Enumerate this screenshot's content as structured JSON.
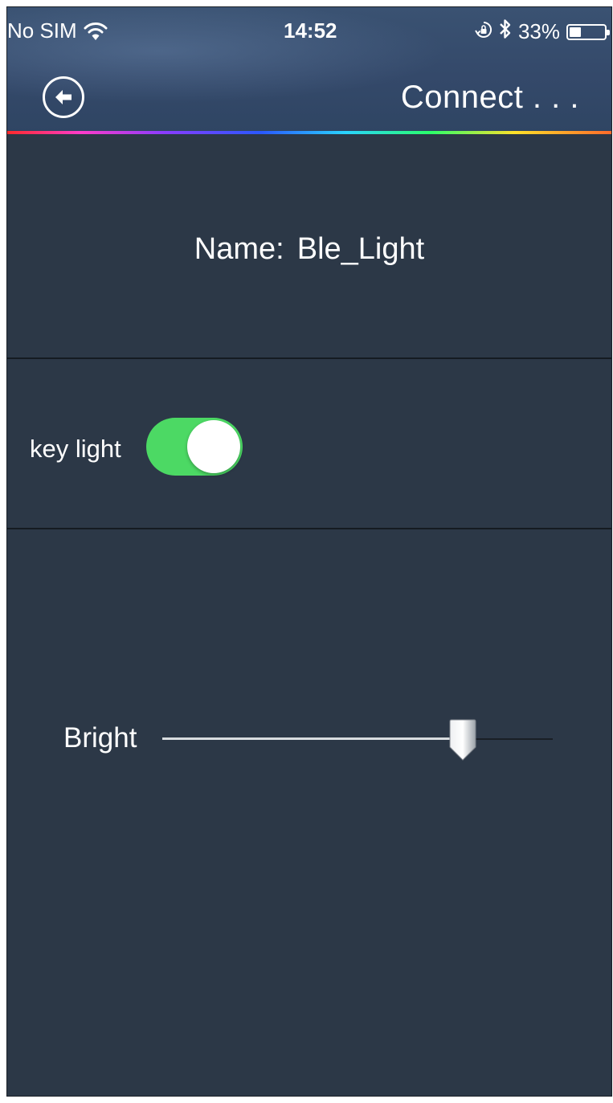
{
  "status_bar": {
    "carrier": "No SIM",
    "time": "14:52",
    "battery_percent": "33%",
    "battery_level": 0.33,
    "wifi_icon": "wifi-icon",
    "orientation_lock_icon": "orientation-lock-icon",
    "bluetooth_icon": "bluetooth-icon"
  },
  "nav": {
    "back_icon": "back-arrow-icon",
    "title": "Connect . . ."
  },
  "device": {
    "name_label": "Name:",
    "name_value": "Ble_Light"
  },
  "key_light": {
    "label": "key light",
    "on": true
  },
  "brightness": {
    "label": "Bright",
    "value_fraction": 0.77
  },
  "colors": {
    "background": "#2c3847",
    "header": "#34496a",
    "toggle_on": "#4cd964",
    "text": "#ffffff"
  }
}
